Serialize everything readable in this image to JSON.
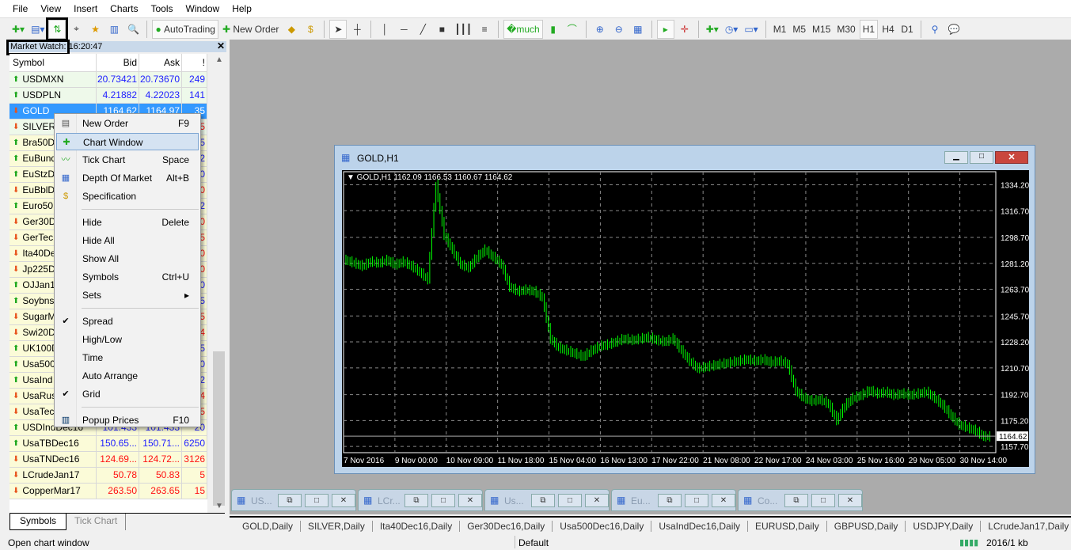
{
  "menu": [
    "File",
    "View",
    "Insert",
    "Charts",
    "Tools",
    "Window",
    "Help"
  ],
  "toolbar": {
    "autotrading": "AutoTrading",
    "new_order": "New Order",
    "timeframes": [
      "M1",
      "M5",
      "M15",
      "M30",
      "H1",
      "H4",
      "D1"
    ],
    "active_timeframe": "H1"
  },
  "market_watch": {
    "title": "Market Watch:",
    "time": "16:20:47",
    "headers": [
      "Symbol",
      "Bid",
      "Ask",
      "!"
    ],
    "rows": [
      {
        "s": "USDMXN",
        "d": "up",
        "b": "20.73421",
        "a": "20.73670",
        "sp": "249",
        "c": "blue"
      },
      {
        "s": "USDPLN",
        "d": "up",
        "b": "4.21882",
        "a": "4.22023",
        "sp": "141",
        "c": "blue"
      },
      {
        "s": "GOLD",
        "d": "dn",
        "b": "1164.62",
        "a": "1164.97",
        "sp": "35",
        "c": "sel"
      },
      {
        "s": "SILVER",
        "d": "dn",
        "b": "",
        "a": "",
        "sp": "5",
        "c": "red"
      },
      {
        "s": "Bra50D",
        "d": "up",
        "b": "",
        "a": "",
        "sp": "5",
        "c": "blue"
      },
      {
        "s": "EuBund",
        "d": "up",
        "b": "",
        "a": "",
        "sp": "2",
        "c": "blue"
      },
      {
        "s": "EuStzD",
        "d": "up",
        "b": "",
        "a": "",
        "sp": "0",
        "c": "blue"
      },
      {
        "s": "EuBblD",
        "d": "dn",
        "b": "",
        "a": "",
        "sp": "0",
        "c": "red"
      },
      {
        "s": "Euro50",
        "d": "up",
        "b": "",
        "a": "",
        "sp": "2",
        "c": "blue"
      },
      {
        "s": "Ger30D",
        "d": "dn",
        "b": "",
        "a": "",
        "sp": "0",
        "c": "red"
      },
      {
        "s": "GerTec",
        "d": "dn",
        "b": "",
        "a": "",
        "sp": "5",
        "c": "red"
      },
      {
        "s": "Ita40De",
        "d": "dn",
        "b": "",
        "a": "",
        "sp": "0",
        "c": "red"
      },
      {
        "s": "Jp225D",
        "d": "dn",
        "b": "",
        "a": "",
        "sp": "0",
        "c": "red"
      },
      {
        "s": "OJJan1",
        "d": "up",
        "b": "",
        "a": "",
        "sp": "0",
        "c": "blue"
      },
      {
        "s": "Soybns",
        "d": "up",
        "b": "",
        "a": "",
        "sp": "5",
        "c": "blue"
      },
      {
        "s": "SugarM",
        "d": "dn",
        "b": "",
        "a": "",
        "sp": "5",
        "c": "red"
      },
      {
        "s": "Swi20D",
        "d": "dn",
        "b": "",
        "a": "",
        "sp": "4",
        "c": "red"
      },
      {
        "s": "UK100D",
        "d": "up",
        "b": "",
        "a": "",
        "sp": "5",
        "c": "blue"
      },
      {
        "s": "Usa500",
        "d": "up",
        "b": "",
        "a": "",
        "sp": "0",
        "c": "blue"
      },
      {
        "s": "UsaInd",
        "d": "up",
        "b": "",
        "a": "",
        "sp": "2",
        "c": "blue"
      },
      {
        "s": "UsaRus",
        "d": "dn",
        "b": "",
        "a": "",
        "sp": "4",
        "c": "red"
      },
      {
        "s": "UsaTec",
        "d": "dn",
        "b": "",
        "a": "",
        "sp": "5",
        "c": "red"
      },
      {
        "s": "USDIndDec16",
        "d": "up",
        "b": "101.433",
        "a": "101.433",
        "sp": "20",
        "c": "blue"
      },
      {
        "s": "UsaTBDec16",
        "d": "up",
        "b": "150.65...",
        "a": "150.71...",
        "sp": "6250",
        "c": "blue"
      },
      {
        "s": "UsaTNDec16",
        "d": "dn",
        "b": "124.69...",
        "a": "124.72...",
        "sp": "3126",
        "c": "red"
      },
      {
        "s": "LCrudeJan17",
        "d": "dn",
        "b": "50.78",
        "a": "50.83",
        "sp": "5",
        "c": "red"
      },
      {
        "s": "CopperMar17",
        "d": "dn",
        "b": "263.50",
        "a": "263.65",
        "sp": "15",
        "c": "red"
      }
    ],
    "tabs": [
      "Symbols",
      "Tick Chart"
    ]
  },
  "context_menu": [
    {
      "label": "New Order",
      "shortcut": "F9",
      "icon": "new-order-icon"
    },
    {
      "label": "Chart Window",
      "shortcut": "",
      "icon": "chart-window-icon",
      "active": true
    },
    {
      "label": "Tick Chart",
      "shortcut": "Space",
      "icon": "tick-chart-icon"
    },
    {
      "label": "Depth Of Market",
      "shortcut": "Alt+B",
      "icon": "depth-of-market-icon"
    },
    {
      "label": "Specification",
      "shortcut": "",
      "icon": "dollar-icon"
    },
    {
      "sep": true
    },
    {
      "label": "Hide",
      "shortcut": "Delete"
    },
    {
      "label": "Hide All",
      "shortcut": ""
    },
    {
      "label": "Show All",
      "shortcut": ""
    },
    {
      "label": "Symbols",
      "shortcut": "Ctrl+U"
    },
    {
      "label": "Sets",
      "shortcut": "▸"
    },
    {
      "sep": true
    },
    {
      "label": "Spread",
      "shortcut": "",
      "checked": true
    },
    {
      "label": "High/Low",
      "shortcut": ""
    },
    {
      "label": "Time",
      "shortcut": ""
    },
    {
      "label": "Auto Arrange",
      "shortcut": ""
    },
    {
      "label": "Grid",
      "shortcut": "",
      "checked": true
    },
    {
      "sep": true
    },
    {
      "label": "Popup Prices",
      "shortcut": "F10",
      "icon": "popup-prices-icon"
    }
  ],
  "chart_window": {
    "title": "GOLD,H1",
    "info": "GOLD,H1  1162.09 1166.53 1160.67 1164.62"
  },
  "chart_data": {
    "type": "bar",
    "symbol": "GOLD,H1",
    "grid": true,
    "bar_color": "#00ff00",
    "background": "#000000",
    "y_ticks": [
      1334.2,
      1316.7,
      1298.7,
      1281.2,
      1263.7,
      1245.7,
      1228.2,
      1210.7,
      1192.7,
      1175.2,
      1157.7
    ],
    "ylim": [
      1153.5,
      1343
    ],
    "current_price": "1164.62",
    "x_ticks": [
      "7 Nov 2016",
      "9 Nov 00:00",
      "10 Nov 09:00",
      "11 Nov 18:00",
      "15 Nov 04:00",
      "16 Nov 13:00",
      "17 Nov 22:00",
      "21 Nov 08:00",
      "22 Nov 17:00",
      "24 Nov 03:00",
      "25 Nov 16:00",
      "29 Nov 05:00",
      "30 Nov 14:00"
    ],
    "values": [
      1283,
      1281,
      1279,
      1282,
      1281,
      1283,
      1280,
      1282,
      1279,
      1275,
      1270,
      1334,
      1300,
      1290,
      1280,
      1278,
      1285,
      1290,
      1285,
      1280,
      1265,
      1262,
      1263,
      1262,
      1258,
      1230,
      1224,
      1222,
      1220,
      1218,
      1222,
      1225,
      1226,
      1228,
      1230,
      1229,
      1230,
      1231,
      1229,
      1228,
      1230,
      1222,
      1215,
      1210,
      1211,
      1212,
      1213,
      1214,
      1215,
      1216,
      1215,
      1216,
      1214,
      1215,
      1213,
      1195,
      1190,
      1188,
      1189,
      1186,
      1175,
      1185,
      1190,
      1192,
      1195,
      1193,
      1194,
      1192,
      1193,
      1192,
      1193,
      1194,
      1190,
      1185,
      1178,
      1172,
      1170,
      1168,
      1164
    ]
  },
  "minimized": [
    "US...",
    "LCr...",
    "Us...",
    "Eu...",
    "Co..."
  ],
  "chart_tabs": [
    "GOLD,Daily",
    "SILVER,Daily",
    "Ita40Dec16,Daily",
    "Ger30Dec16,Daily",
    "Usa500Dec16,Daily",
    "UsaIndDec16,Daily",
    "EURUSD,Daily",
    "GBPUSD,Daily",
    "USDJPY,Daily",
    "LCrudeJan17,Daily"
  ],
  "status": {
    "hint": "Open chart window",
    "profile": "Default",
    "traffic": "2016/1 kb"
  }
}
